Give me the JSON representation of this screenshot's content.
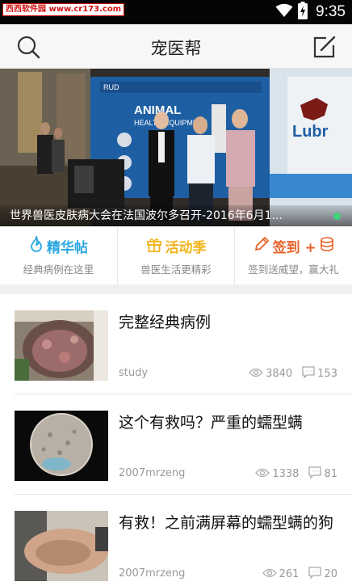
{
  "status_bar": {
    "watermark": "西西软件园 www.cr173.com",
    "time": "9:35"
  },
  "app_bar": {
    "title": "宠医帮"
  },
  "banner": {
    "caption": "世界兽医皮肤病大会在法国波尔多召开-2016年6月1..."
  },
  "quick_nav": [
    {
      "title": "精华帖",
      "subtitle": "经典病例在这里",
      "color": "#2aa7e0"
    },
    {
      "title": "活动季",
      "subtitle": "兽医生活更精彩",
      "color": "#f2b51b"
    },
    {
      "title": "签到 +",
      "subtitle": "签到送威望，赢大礼",
      "color": "#e8632b"
    }
  ],
  "posts": [
    {
      "title": "完整经典病例",
      "author": "study",
      "views": "3840",
      "comments": "153"
    },
    {
      "title": "这个有救吗？严重的蠕型螨",
      "author": "2007mrzeng",
      "views": "1338",
      "comments": "81"
    },
    {
      "title": "有救！之前满屏幕的蠕型螨的狗",
      "author": "2007mrzeng",
      "views": "261",
      "comments": "20"
    }
  ]
}
